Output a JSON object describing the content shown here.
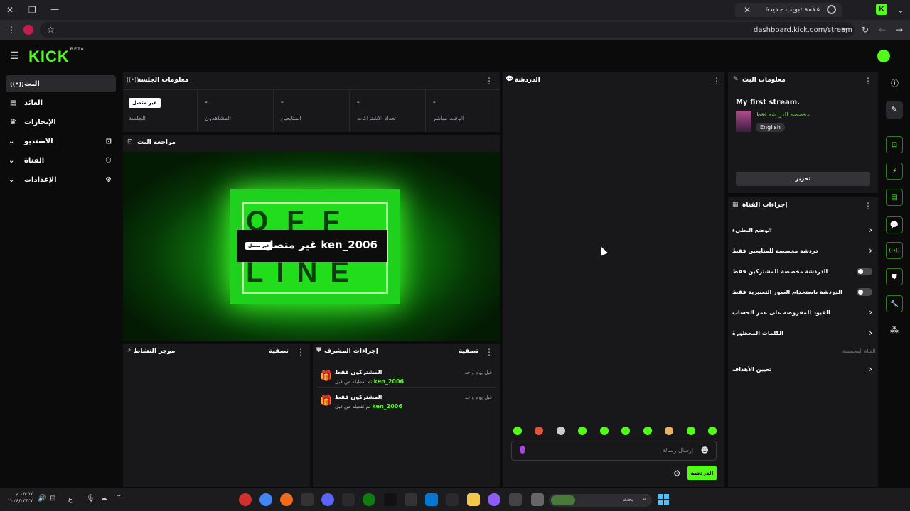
{
  "browser": {
    "tab_title": "علامة تبويب جديدة",
    "url": "dashboard.kick.com/stream"
  },
  "brand": {
    "logo": "KICK",
    "beta": "BETA",
    "accent": "#53fc18"
  },
  "sidebar": {
    "items": [
      {
        "label": "البث",
        "icon": "broadcast-icon",
        "active": true
      },
      {
        "label": "العائد",
        "icon": "revenue-icon"
      },
      {
        "label": "الإنجازات",
        "icon": "trophy-icon"
      },
      {
        "label": "الاستديو",
        "icon": "studio-icon"
      },
      {
        "label": "القناة",
        "icon": "channel-icon"
      },
      {
        "label": "الإعدادات",
        "icon": "gear-icon"
      }
    ]
  },
  "session": {
    "title": "معلومات الجلسة",
    "status_badge": "غير متصل",
    "stats": [
      {
        "value": "",
        "label": "الجلسة"
      },
      {
        "value": "-",
        "label": "المشاهدون"
      },
      {
        "value": "-",
        "label": "المتابعين"
      },
      {
        "value": "-",
        "label": "تعداد الاشتراكات"
      },
      {
        "value": "-",
        "label": "الوقت مباشر"
      }
    ]
  },
  "preview": {
    "title": "مراجعة البث",
    "overlay_text": "غير متصل ken_2006",
    "overlay_badge": "غير متصل",
    "sign_top": "OFF",
    "sign_bottom": "LINE"
  },
  "activity": {
    "title": "موجز النشاط",
    "filter": "تصفية"
  },
  "mod": {
    "title": "إجراءات المشرف",
    "filter": "تصفية",
    "items": [
      {
        "title": "المشتركون فقط",
        "desc": "تم تعطيله من قبل",
        "user": "ken_2006",
        "time": "قبل يوم واحد"
      },
      {
        "title": "المشتركون فقط",
        "desc": "تم تفعيله من قبل",
        "user": "ken_2006",
        "time": "قبل يوم واحد"
      }
    ]
  },
  "chat": {
    "title": "الدردشة",
    "placeholder": "إرسال رسالة",
    "send_label": "الدردشة"
  },
  "stream_info": {
    "title": "معلومات البث",
    "stream_title": "My first stream.",
    "category": "مخصصة للدردشة فقط",
    "language": "English",
    "edit_label": "تحرير"
  },
  "channel_actions": {
    "title": "إجراءات القناة",
    "rows": [
      {
        "label": "الوضع البطيء",
        "type": "chevron"
      },
      {
        "label": "دردشة مخصصة للمتابعين فقط",
        "type": "chevron"
      },
      {
        "label": "الدردشة مخصصة للمشتركين فقط",
        "type": "toggle"
      },
      {
        "label": "الدردشة باستخدام الصور التعبيرية فقط",
        "type": "toggle"
      },
      {
        "label": "القيود المفروضة على عمر الحساب",
        "type": "chevron"
      },
      {
        "label": "الكلمات المحظورة",
        "type": "chevron"
      }
    ],
    "section_label": "القناة المخصصة",
    "goals": "تعيين الأهداف"
  },
  "taskbar": {
    "search": "بحث",
    "lang": "ع",
    "time": "٠٥:٥٧ م",
    "date": "٢٠٢٤/٠٣/٢٧"
  }
}
